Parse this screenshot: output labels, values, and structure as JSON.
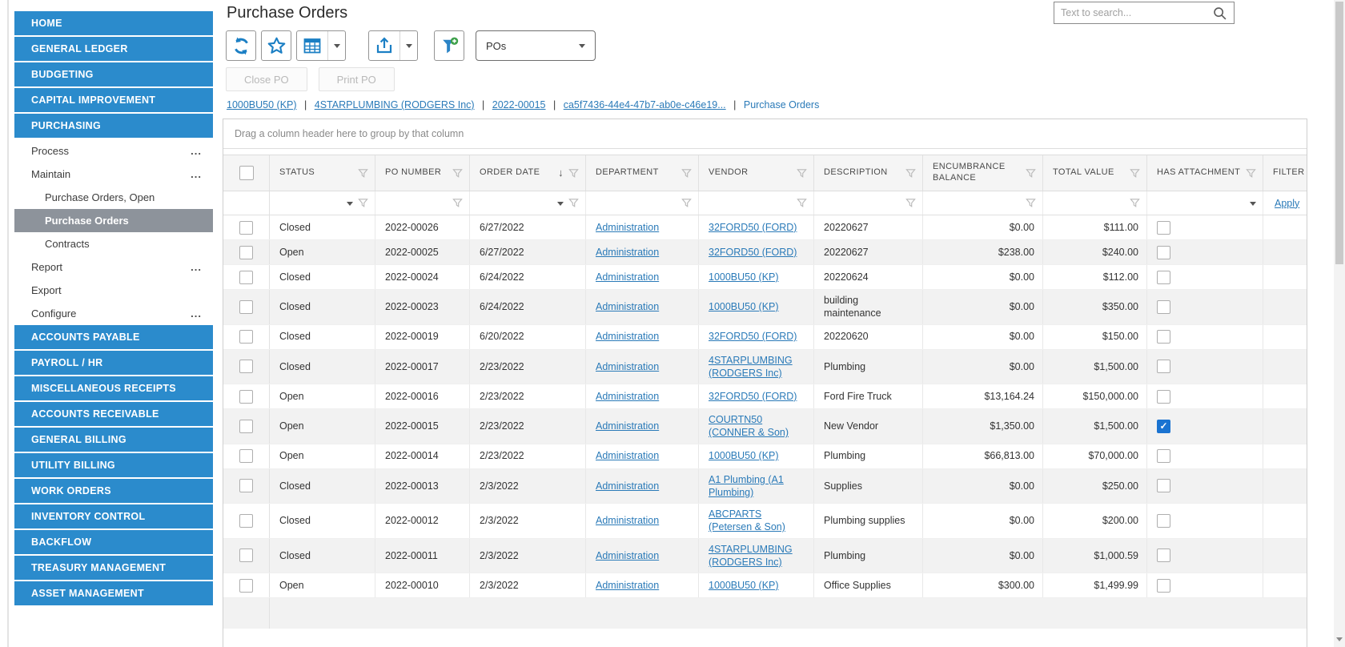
{
  "app": {
    "page_title": "Purchase Orders",
    "search_placeholder": "Text to search..."
  },
  "colors": {
    "sidebar_blue": "#2b8bcc",
    "selected_gray": "#8d939b",
    "link_blue": "#2a7ab8",
    "toolbar_icon_blue": "#1b7fc4",
    "checked_checkbox_blue": "#1a73d1",
    "add_badge_green": "#3da04a"
  },
  "icons": {
    "ellipsis_glyph": "...",
    "sort_desc_glyph": "↓",
    "check_glyph": "✓"
  },
  "sidebar": {
    "items": [
      {
        "label": "HOME",
        "type": "module"
      },
      {
        "label": "GENERAL LEDGER",
        "type": "module"
      },
      {
        "label": "BUDGETING",
        "type": "module"
      },
      {
        "label": "CAPITAL IMPROVEMENT",
        "type": "module"
      },
      {
        "label": "PURCHASING",
        "type": "module",
        "expanded": true
      },
      {
        "label": "Process",
        "type": "menu",
        "ellipsis": true
      },
      {
        "label": "Maintain",
        "type": "menu",
        "ellipsis": true
      },
      {
        "label": "Purchase Orders, Open",
        "type": "submenu"
      },
      {
        "label": "Purchase Orders",
        "type": "submenu",
        "selected": true
      },
      {
        "label": "Contracts",
        "type": "submenu"
      },
      {
        "label": "Report",
        "type": "menu",
        "ellipsis": true
      },
      {
        "label": "Export",
        "type": "menu"
      },
      {
        "label": "Configure",
        "type": "menu",
        "ellipsis": true
      },
      {
        "label": "ACCOUNTS PAYABLE",
        "type": "module"
      },
      {
        "label": "PAYROLL / HR",
        "type": "module"
      },
      {
        "label": "MISCELLANEOUS RECEIPTS",
        "type": "module"
      },
      {
        "label": "ACCOUNTS RECEIVABLE",
        "type": "module"
      },
      {
        "label": "GENERAL BILLING",
        "type": "module"
      },
      {
        "label": "UTILITY BILLING",
        "type": "module"
      },
      {
        "label": "WORK ORDERS",
        "type": "module"
      },
      {
        "label": "INVENTORY CONTROL",
        "type": "module"
      },
      {
        "label": "BACKFLOW",
        "type": "module"
      },
      {
        "label": "TREASURY MANAGEMENT",
        "type": "module"
      },
      {
        "label": "ASSET MANAGEMENT",
        "type": "module"
      }
    ]
  },
  "toolbar": {
    "view_select_value": "POs",
    "actions": [
      {
        "label": "Close PO",
        "disabled": true
      },
      {
        "label": "Print PO",
        "disabled": true
      }
    ]
  },
  "breadcrumb": {
    "links": [
      "1000BU50 (KP)",
      "4STARPLUMBING (RODGERS Inc)",
      "2022-00015",
      "ca5f7436-44e4-47b7-ab0e-c46e19..."
    ],
    "current": "Purchase Orders",
    "separator": "|"
  },
  "table": {
    "group_hint": "Drag a column header here to group by that column",
    "filter_apply_label": "Apply",
    "columns": [
      {
        "key": "status",
        "label": "STATUS",
        "filter_ui": "caret-funnel"
      },
      {
        "key": "po_number",
        "label": "PO NUMBER",
        "filter_ui": "funnel"
      },
      {
        "key": "order_date",
        "label": "ORDER DATE",
        "sort": "desc",
        "filter_ui": "caret-funnel"
      },
      {
        "key": "department",
        "label": "DEPARTMENT",
        "link": true,
        "filter_ui": "funnel"
      },
      {
        "key": "vendor",
        "label": "VENDOR",
        "link": true,
        "filter_ui": "funnel"
      },
      {
        "key": "description",
        "label": "DESCRIPTION",
        "filter_ui": "funnel"
      },
      {
        "key": "encumbrance_balance",
        "label": "ENCUMBRANCE BALANCE",
        "align": "right",
        "filter_ui": "funnel"
      },
      {
        "key": "total_value",
        "label": "TOTAL VALUE",
        "align": "right",
        "filter_ui": "funnel"
      },
      {
        "key": "has_attachment",
        "label": "HAS ATTACHMENT",
        "type": "checkbox",
        "filter_ui": "caret"
      },
      {
        "key": "filter",
        "label": "FILTER",
        "type": "filter",
        "filter_ui": "apply"
      }
    ],
    "rows": [
      {
        "status": "Closed",
        "po_number": "2022-00026",
        "order_date": "6/27/2022",
        "department": "Administration",
        "vendor": "32FORD50 (FORD)",
        "description": "20220627",
        "encumbrance_balance": "$0.00",
        "total_value": "$111.00",
        "has_attachment": false
      },
      {
        "status": "Open",
        "po_number": "2022-00025",
        "order_date": "6/27/2022",
        "department": "Administration",
        "vendor": "32FORD50 (FORD)",
        "description": "20220627",
        "encumbrance_balance": "$238.00",
        "total_value": "$240.00",
        "has_attachment": false
      },
      {
        "status": "Closed",
        "po_number": "2022-00024",
        "order_date": "6/24/2022",
        "department": "Administration",
        "vendor": "1000BU50 (KP)",
        "description": "20220624",
        "encumbrance_balance": "$0.00",
        "total_value": "$112.00",
        "has_attachment": false
      },
      {
        "status": "Closed",
        "po_number": "2022-00023",
        "order_date": "6/24/2022",
        "department": "Administration",
        "vendor": "1000BU50 (KP)",
        "description": "building maintenance",
        "encumbrance_balance": "$0.00",
        "total_value": "$350.00",
        "has_attachment": false
      },
      {
        "status": "Closed",
        "po_number": "2022-00019",
        "order_date": "6/20/2022",
        "department": "Administration",
        "vendor": "32FORD50 (FORD)",
        "description": "20220620",
        "encumbrance_balance": "$0.00",
        "total_value": "$150.00",
        "has_attachment": false
      },
      {
        "status": "Closed",
        "po_number": "2022-00017",
        "order_date": "2/23/2022",
        "department": "Administration",
        "vendor": "4STARPLUMBING (RODGERS Inc)",
        "description": "Plumbing",
        "encumbrance_balance": "$0.00",
        "total_value": "$1,500.00",
        "has_attachment": false
      },
      {
        "status": "Open",
        "po_number": "2022-00016",
        "order_date": "2/23/2022",
        "department": "Administration",
        "vendor": "32FORD50 (FORD)",
        "description": "Ford Fire Truck",
        "encumbrance_balance": "$13,164.24",
        "total_value": "$150,000.00",
        "has_attachment": false
      },
      {
        "status": "Open",
        "po_number": "2022-00015",
        "order_date": "2/23/2022",
        "department": "Administration",
        "vendor": "COURTN50 (CONNER & Son)",
        "description": "New Vendor",
        "encumbrance_balance": "$1,350.00",
        "total_value": "$1,500.00",
        "has_attachment": true
      },
      {
        "status": "Open",
        "po_number": "2022-00014",
        "order_date": "2/23/2022",
        "department": "Administration",
        "vendor": "1000BU50 (KP)",
        "description": "Plumbing",
        "encumbrance_balance": "$66,813.00",
        "total_value": "$70,000.00",
        "has_attachment": false
      },
      {
        "status": "Closed",
        "po_number": "2022-00013",
        "order_date": "2/3/2022",
        "department": "Administration",
        "vendor": "A1 Plumbing (A1 Plumbing)",
        "description": "Supplies",
        "encumbrance_balance": "$0.00",
        "total_value": "$250.00",
        "has_attachment": false
      },
      {
        "status": "Closed",
        "po_number": "2022-00012",
        "order_date": "2/3/2022",
        "department": "Administration",
        "vendor": "ABCPARTS (Petersen & Son)",
        "description": "Plumbing supplies",
        "encumbrance_balance": "$0.00",
        "total_value": "$200.00",
        "has_attachment": false
      },
      {
        "status": "Closed",
        "po_number": "2022-00011",
        "order_date": "2/3/2022",
        "department": "Administration",
        "vendor": "4STARPLUMBING (RODGERS Inc)",
        "description": "Plumbing",
        "encumbrance_balance": "$0.00",
        "total_value": "$1,000.59",
        "has_attachment": false
      },
      {
        "status": "Open",
        "po_number": "2022-00010",
        "order_date": "2/3/2022",
        "department": "Administration",
        "vendor": "1000BU50 (KP)",
        "description": "Office Supplies",
        "encumbrance_balance": "$300.00",
        "total_value": "$1,499.99",
        "has_attachment": false
      }
    ]
  }
}
